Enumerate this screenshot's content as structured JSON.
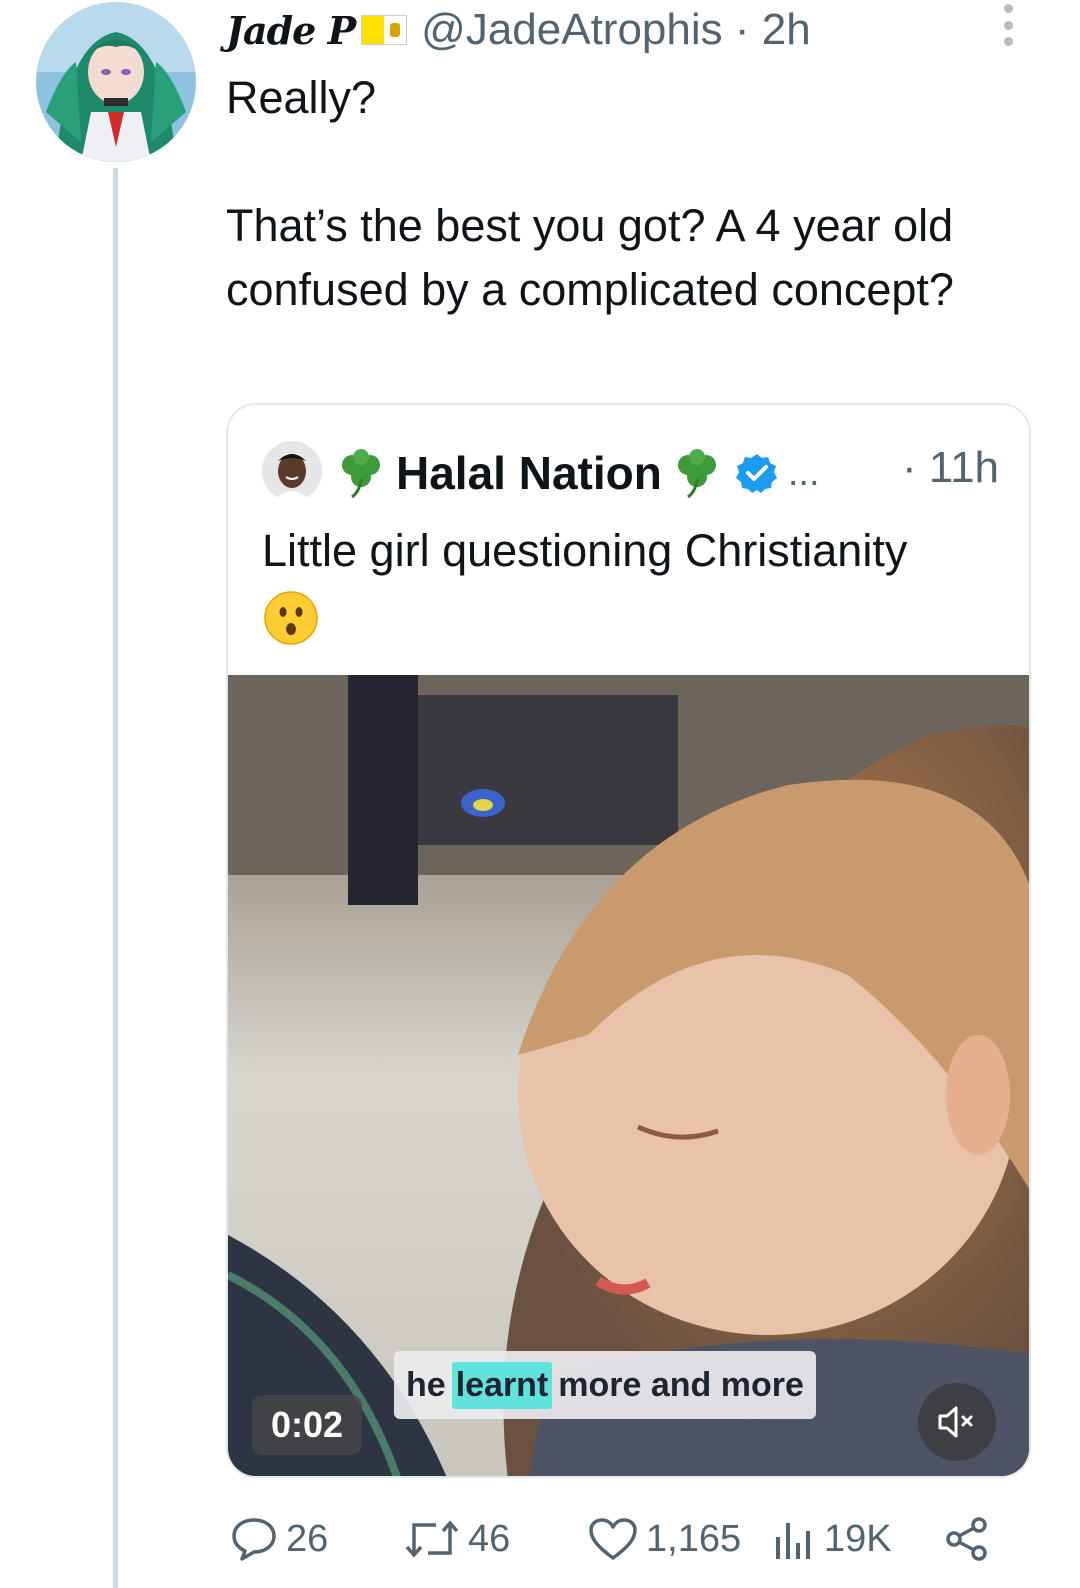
{
  "tweet": {
    "display_name": "Jade P",
    "handle": "@JadeAtrophis",
    "separator": "·",
    "time": "2h",
    "text": "Really?\n\nThat’s the best you got? A 4 year old confused by a complicated concept?"
  },
  "quote": {
    "display_name": "Halal Nation",
    "ellipsis": "...",
    "time": "· 11h",
    "text": "Little girl questioning Christianity",
    "video": {
      "caption_before": "he",
      "caption_highlight": "learnt",
      "caption_after": "more and more",
      "elapsed": "0:02"
    }
  },
  "actions": {
    "replies": "26",
    "reposts": "46",
    "likes": "1,165",
    "views": "19K"
  },
  "colors": {
    "text": "#0f1419",
    "secondary": "#536471",
    "border": "#e3e8eb",
    "verified": "#1d9bf0",
    "caption_highlight": "#5fe3dc"
  },
  "icons": [
    "more-icon",
    "clover-icon",
    "verified-badge-icon",
    "surprised-emoji",
    "mute-icon",
    "reply-icon",
    "repost-icon",
    "like-icon",
    "views-icon",
    "share-icon"
  ]
}
